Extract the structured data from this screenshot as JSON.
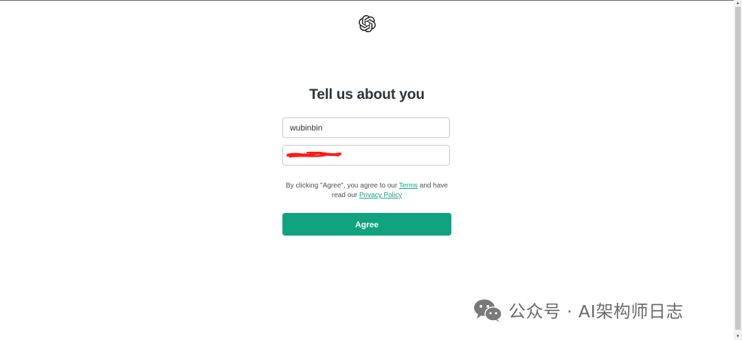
{
  "app": {
    "logo_icon": "openai-logo-icon"
  },
  "form": {
    "title": "Tell us about you",
    "name_value": "wubinbin",
    "birthday_value": "",
    "terms_prefix": "By clicking \"Agree\", you agree to our ",
    "terms_link": "Terms",
    "terms_middle": " and have read our ",
    "privacy_link": "Privacy Policy",
    "agree_label": "Agree"
  },
  "watermark": {
    "icon": "wechat-icon",
    "text": "公众号 · AI架构师日志"
  },
  "colors": {
    "accent": "#10a37f",
    "redaction": "#ff1a1a"
  }
}
